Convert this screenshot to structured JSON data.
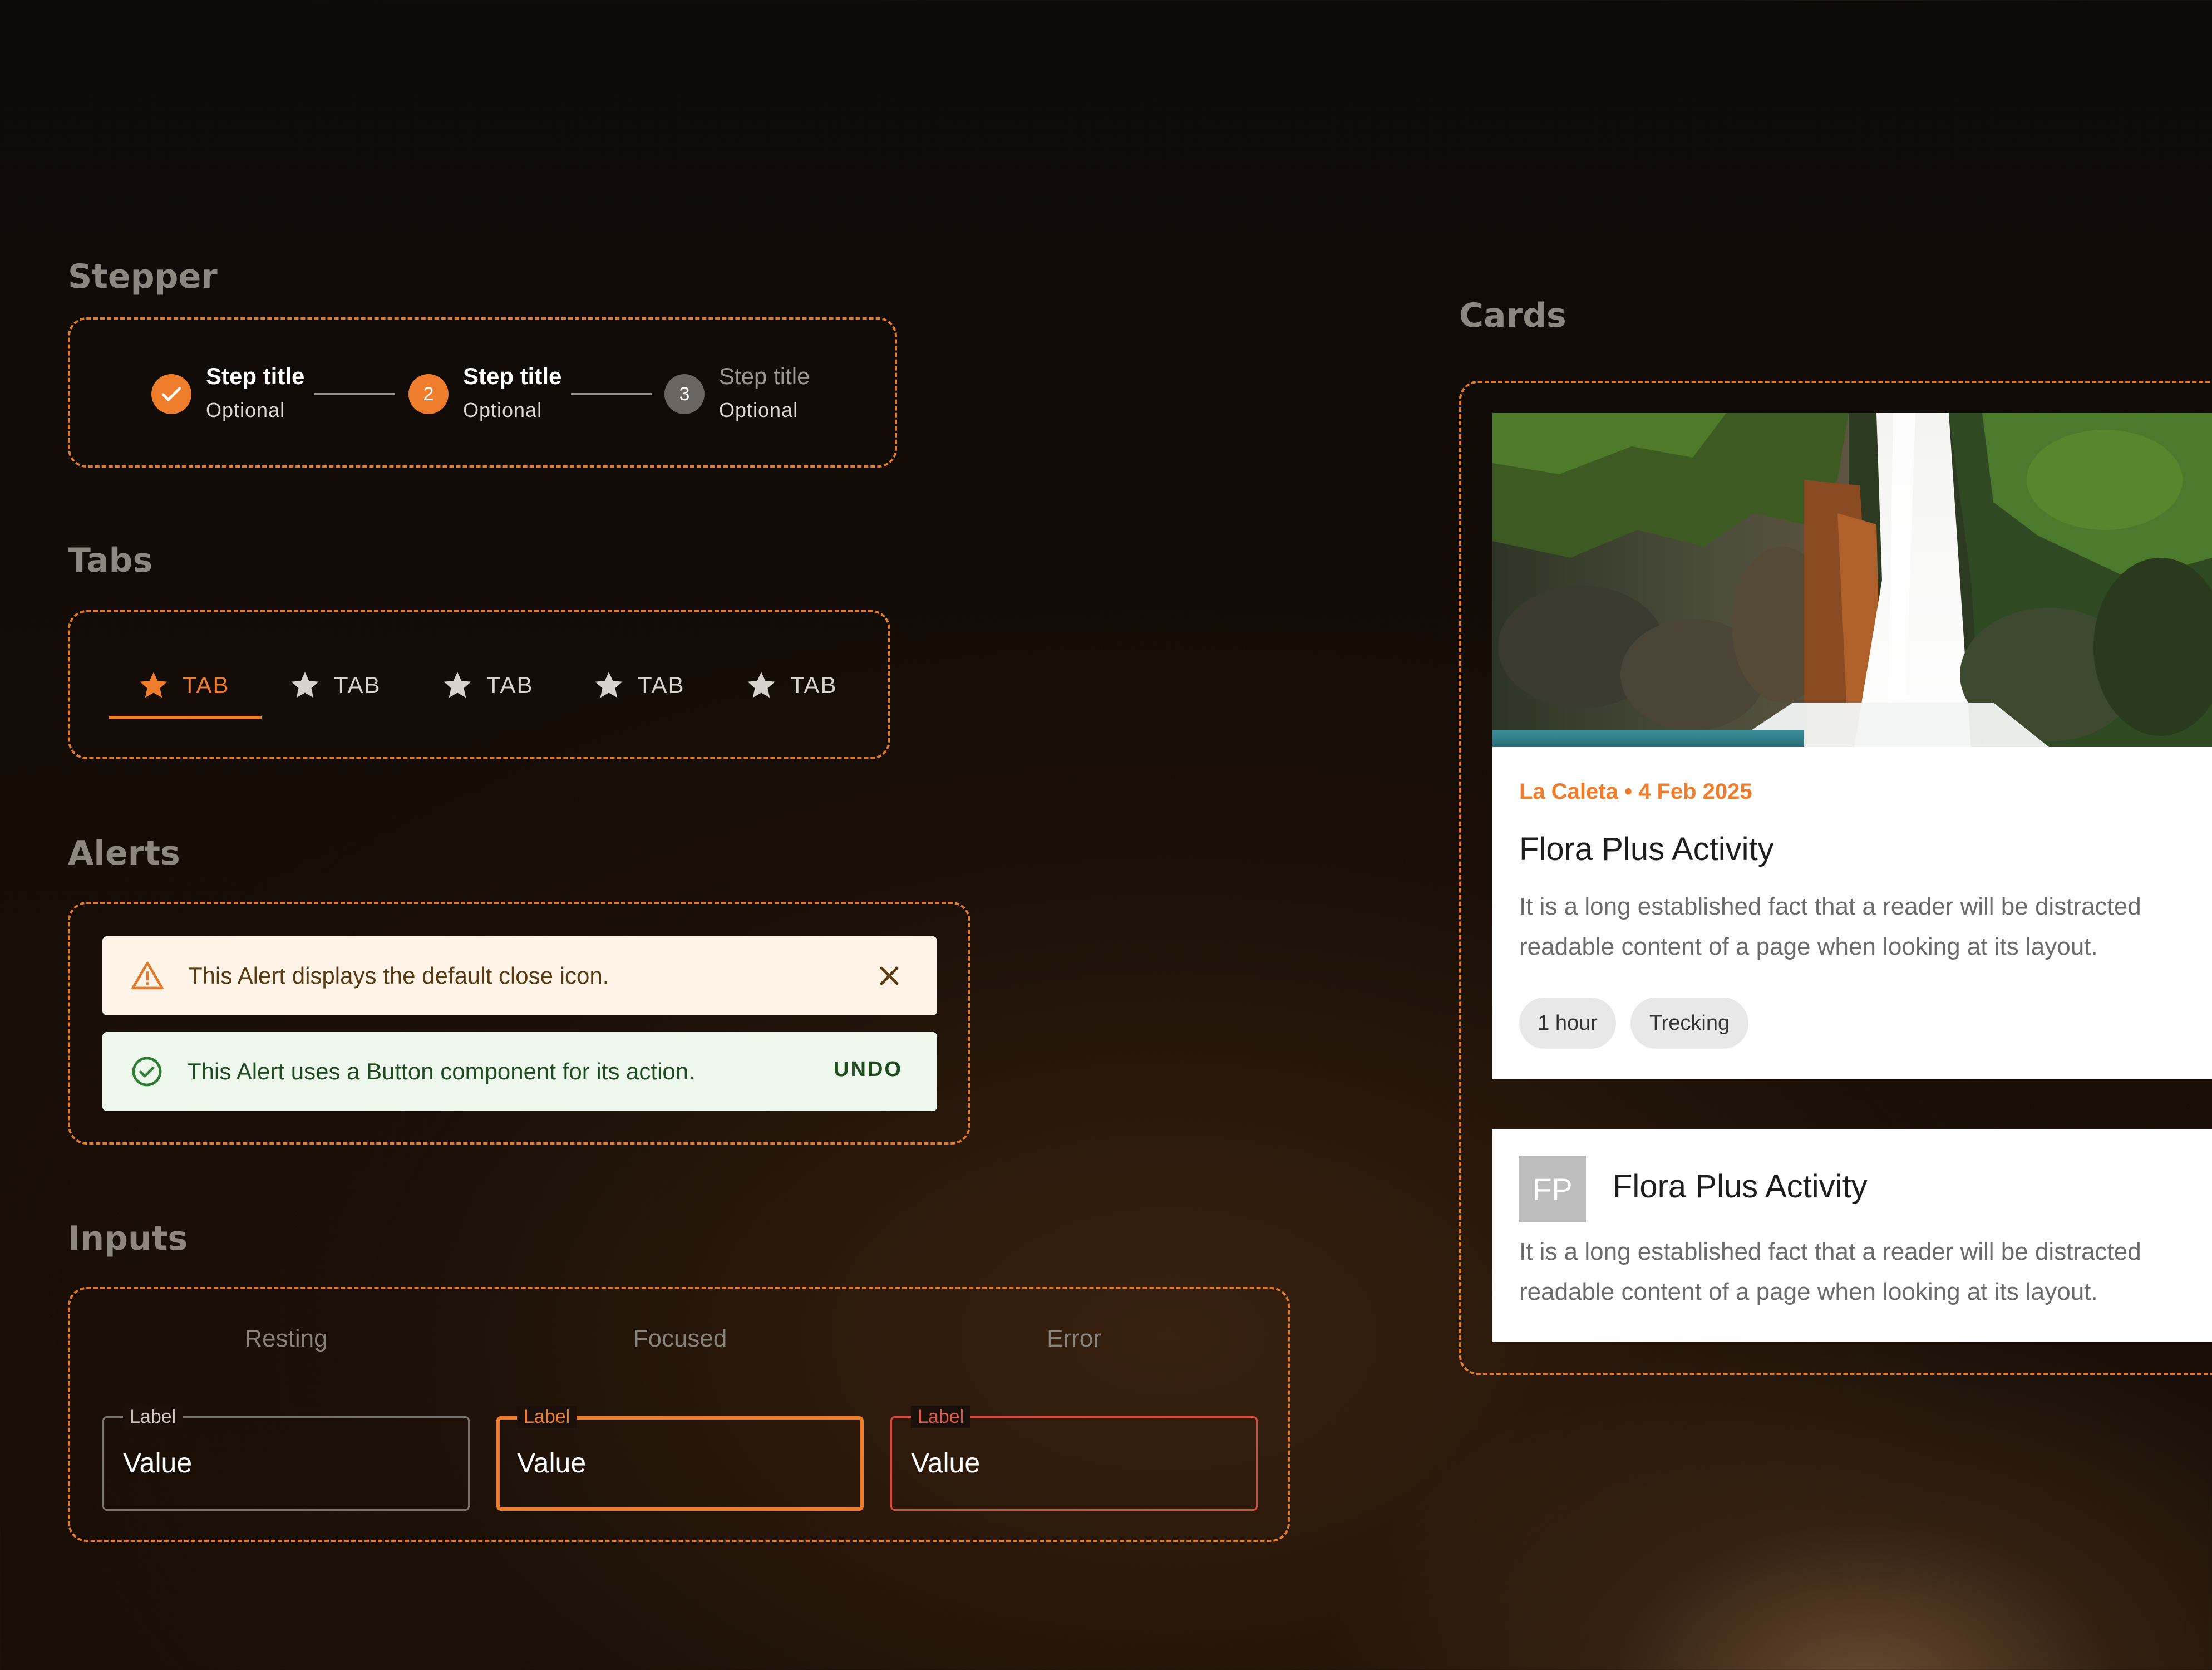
{
  "stepper": {
    "title": "Stepper",
    "steps": [
      {
        "icon": "check-icon",
        "number": "",
        "title": "Step title",
        "subtitle": "Optional",
        "state": "completed"
      },
      {
        "icon": "",
        "number": "2",
        "title": "Step title",
        "subtitle": "Optional",
        "state": "active"
      },
      {
        "icon": "",
        "number": "3",
        "title": "Step title",
        "subtitle": "Optional",
        "state": "inactive"
      }
    ]
  },
  "tabs": {
    "title": "Tabs",
    "items": [
      {
        "label": "TAB",
        "icon": "star-icon",
        "active": true
      },
      {
        "label": "TAB",
        "icon": "star-icon",
        "active": false
      },
      {
        "label": "TAB",
        "icon": "star-icon",
        "active": false
      },
      {
        "label": "TAB",
        "icon": "star-icon",
        "active": false
      },
      {
        "label": "TAB",
        "icon": "star-icon",
        "active": false
      }
    ]
  },
  "alerts": {
    "title": "Alerts",
    "warning": {
      "text": "This Alert displays the default close icon.",
      "icon": "warning-icon",
      "action_icon": "close-icon"
    },
    "success": {
      "text": "This Alert uses a Button component for its action.",
      "icon": "check-circle-icon",
      "action_label": "UNDO"
    }
  },
  "inputs": {
    "title": "Inputs",
    "columns": [
      "Resting",
      "Focused",
      "Error"
    ],
    "fields": [
      {
        "label": "Label",
        "value": "Value",
        "state": "resting"
      },
      {
        "label": "Label",
        "value": "Value",
        "state": "focused"
      },
      {
        "label": "Label",
        "value": "Value",
        "state": "error"
      }
    ]
  },
  "cards": {
    "title": "Cards",
    "media_card": {
      "meta": "La Caleta • 4 Feb 2025",
      "title": "Flora Plus Activity",
      "body_line1": "It is a long established fact that a reader will be distracted",
      "body_line2": "readable content of a page when looking at its layout.",
      "chips": [
        "1 hour",
        "Trecking"
      ]
    },
    "avatar_card": {
      "avatar": "FP",
      "title": "Flora Plus Activity",
      "body_line1": "It is a long established fact that a reader will be distracted",
      "body_line2": "readable content of a page when looking at its layout."
    }
  },
  "colors": {
    "accent": "#ef7d2c",
    "frame_border": "#e07a2c",
    "error": "#d94a3a",
    "warning_bg": "#fdf3e6",
    "success_bg": "#edf7ec"
  }
}
